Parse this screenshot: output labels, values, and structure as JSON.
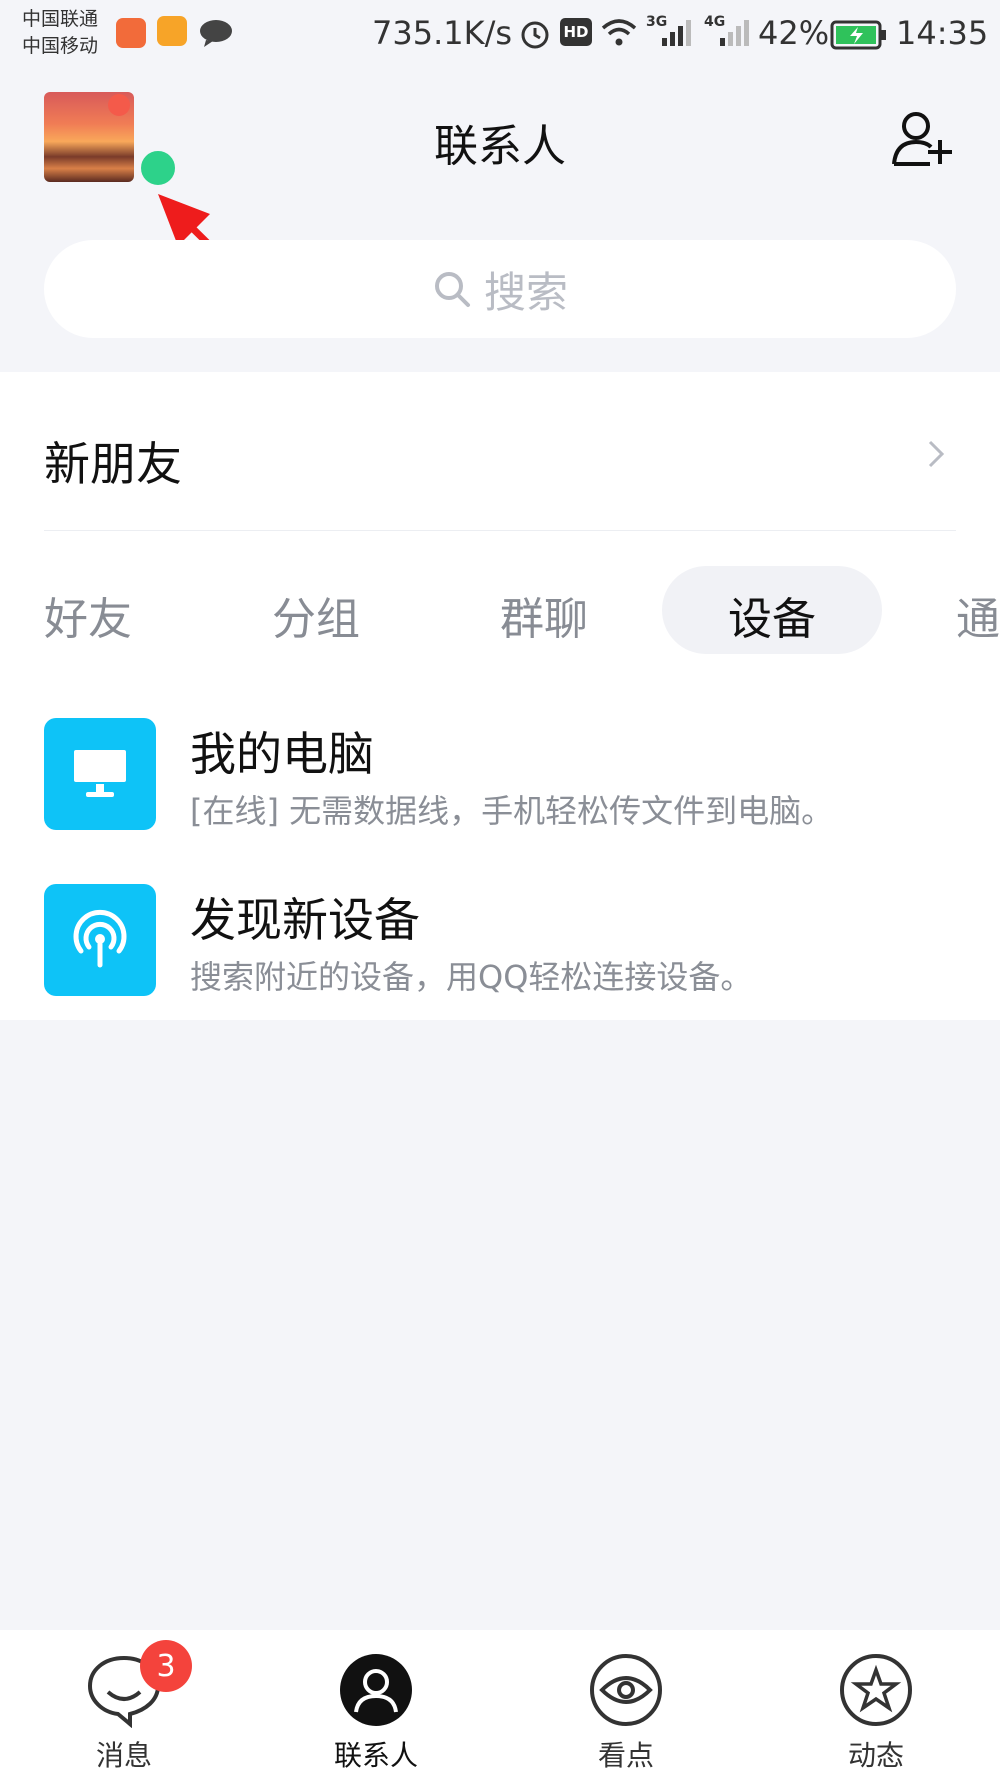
{
  "status_bar": {
    "carrier_1": "中国联通",
    "carrier_2": "中国移动",
    "network_speed": "735.1K/s",
    "battery": "42%",
    "time": "14:35",
    "net_3g": "3G",
    "net_4g": "4G",
    "hd": "HD"
  },
  "header": {
    "title": "联系人"
  },
  "search": {
    "placeholder": "搜索"
  },
  "new_friends": {
    "label": "新朋友"
  },
  "tabs": [
    {
      "label": "好友",
      "active": false
    },
    {
      "label": "分组",
      "active": false
    },
    {
      "label": "群聊",
      "active": false
    },
    {
      "label": "设备",
      "active": true
    },
    {
      "label": "通",
      "active": false
    }
  ],
  "devices": [
    {
      "title": "我的电脑",
      "desc": "[在线] 无需数据线，手机轻松传文件到电脑。",
      "icon": "monitor-icon"
    },
    {
      "title": "发现新设备",
      "desc": "搜索附近的设备，用QQ轻松连接设备。",
      "icon": "wireless-icon"
    }
  ],
  "bottom_nav": {
    "items": [
      {
        "label": "消息",
        "icon": "message-icon"
      },
      {
        "label": "联系人",
        "icon": "contacts-icon",
        "active": true
      },
      {
        "label": "看点",
        "icon": "eye-icon"
      },
      {
        "label": "动态",
        "icon": "star-icon"
      }
    ],
    "message_badge": "3"
  },
  "colors": {
    "accent": "#0ec3f7",
    "online": "#2dd28a",
    "badge": "#f4433c",
    "annotation_arrow": "#ee1c1c"
  }
}
